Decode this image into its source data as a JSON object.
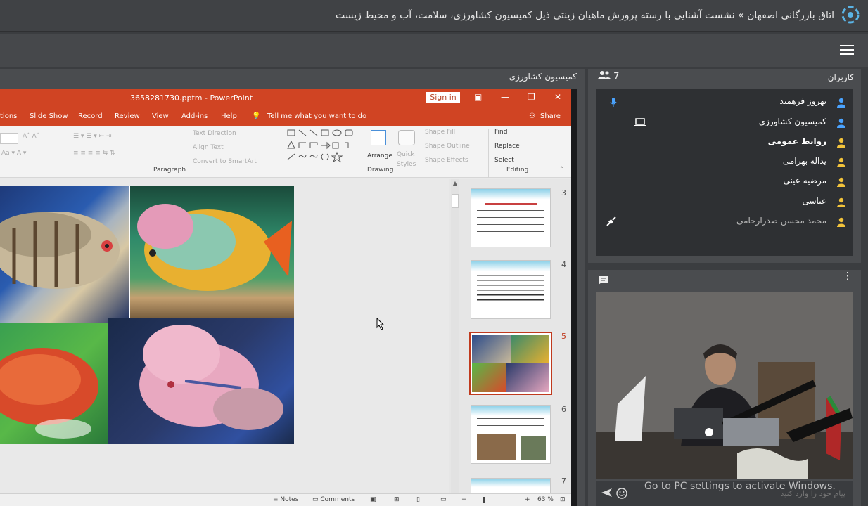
{
  "header": {
    "title": "اتاق بازرگانی اصفهان » نشست آشنایی با رسته پرورش ماهیان زینتی ذیل کمیسیون کشاورزی، سلامت، آب و محیط زیست"
  },
  "presentation": {
    "panel_title": "کمیسیون کشاورزی",
    "ppt": {
      "file_title": "3658281730.pptm - PowerPoint",
      "signin": "Sign in",
      "tabs": [
        "tions",
        "Slide Show",
        "Record",
        "Review",
        "View",
        "Add-ins",
        "Help"
      ],
      "tellme": "Tell me what you want to do",
      "share": "Share",
      "groups": {
        "paragraph": "Paragraph",
        "drawing": "Drawing",
        "editing": "Editing"
      },
      "ribbon_items": {
        "text_direction": "Text Direction",
        "align_text": "Align Text",
        "convert_smartart": "Convert to SmartArt",
        "arrange": "Arrange",
        "quick_styles": "Quick Styles",
        "shape_fill": "Shape Fill",
        "shape_outline": "Shape Outline",
        "shape_effects": "Shape Effects",
        "find": "Find",
        "replace": "Replace",
        "select": "Select"
      },
      "slide_numbers": [
        "3",
        "4",
        "5",
        "6",
        "7"
      ],
      "status": {
        "notes": "Notes",
        "comments": "Comments",
        "zoom": "63 %"
      }
    }
  },
  "users": {
    "title": "کاربران",
    "count": "7",
    "list": [
      {
        "name": "بهروز فرهمند",
        "role": "presenter"
      },
      {
        "name": "کمیسیون کشاورزی",
        "role": "presenter"
      },
      {
        "name": "روابط عمومی",
        "role": "moderator"
      },
      {
        "name": "یداله بهرامی",
        "role": "viewer"
      },
      {
        "name": "مرضیه عینی",
        "role": "viewer"
      },
      {
        "name": "عباسی",
        "role": "viewer"
      },
      {
        "name": "محمد محسن صدرارحامی",
        "role": "viewer"
      }
    ]
  },
  "chat": {
    "placeholder": "پیام خود را وارد کنید"
  },
  "watermark": "Go to PC settings to activate Windows.",
  "colors": {
    "ppt_accent": "#d04423",
    "panel_bg": "#4a4c4f",
    "list_bg": "#2e3033",
    "presenter_icon": "#4aa3ff",
    "viewer_icon": "#f2c33b"
  }
}
